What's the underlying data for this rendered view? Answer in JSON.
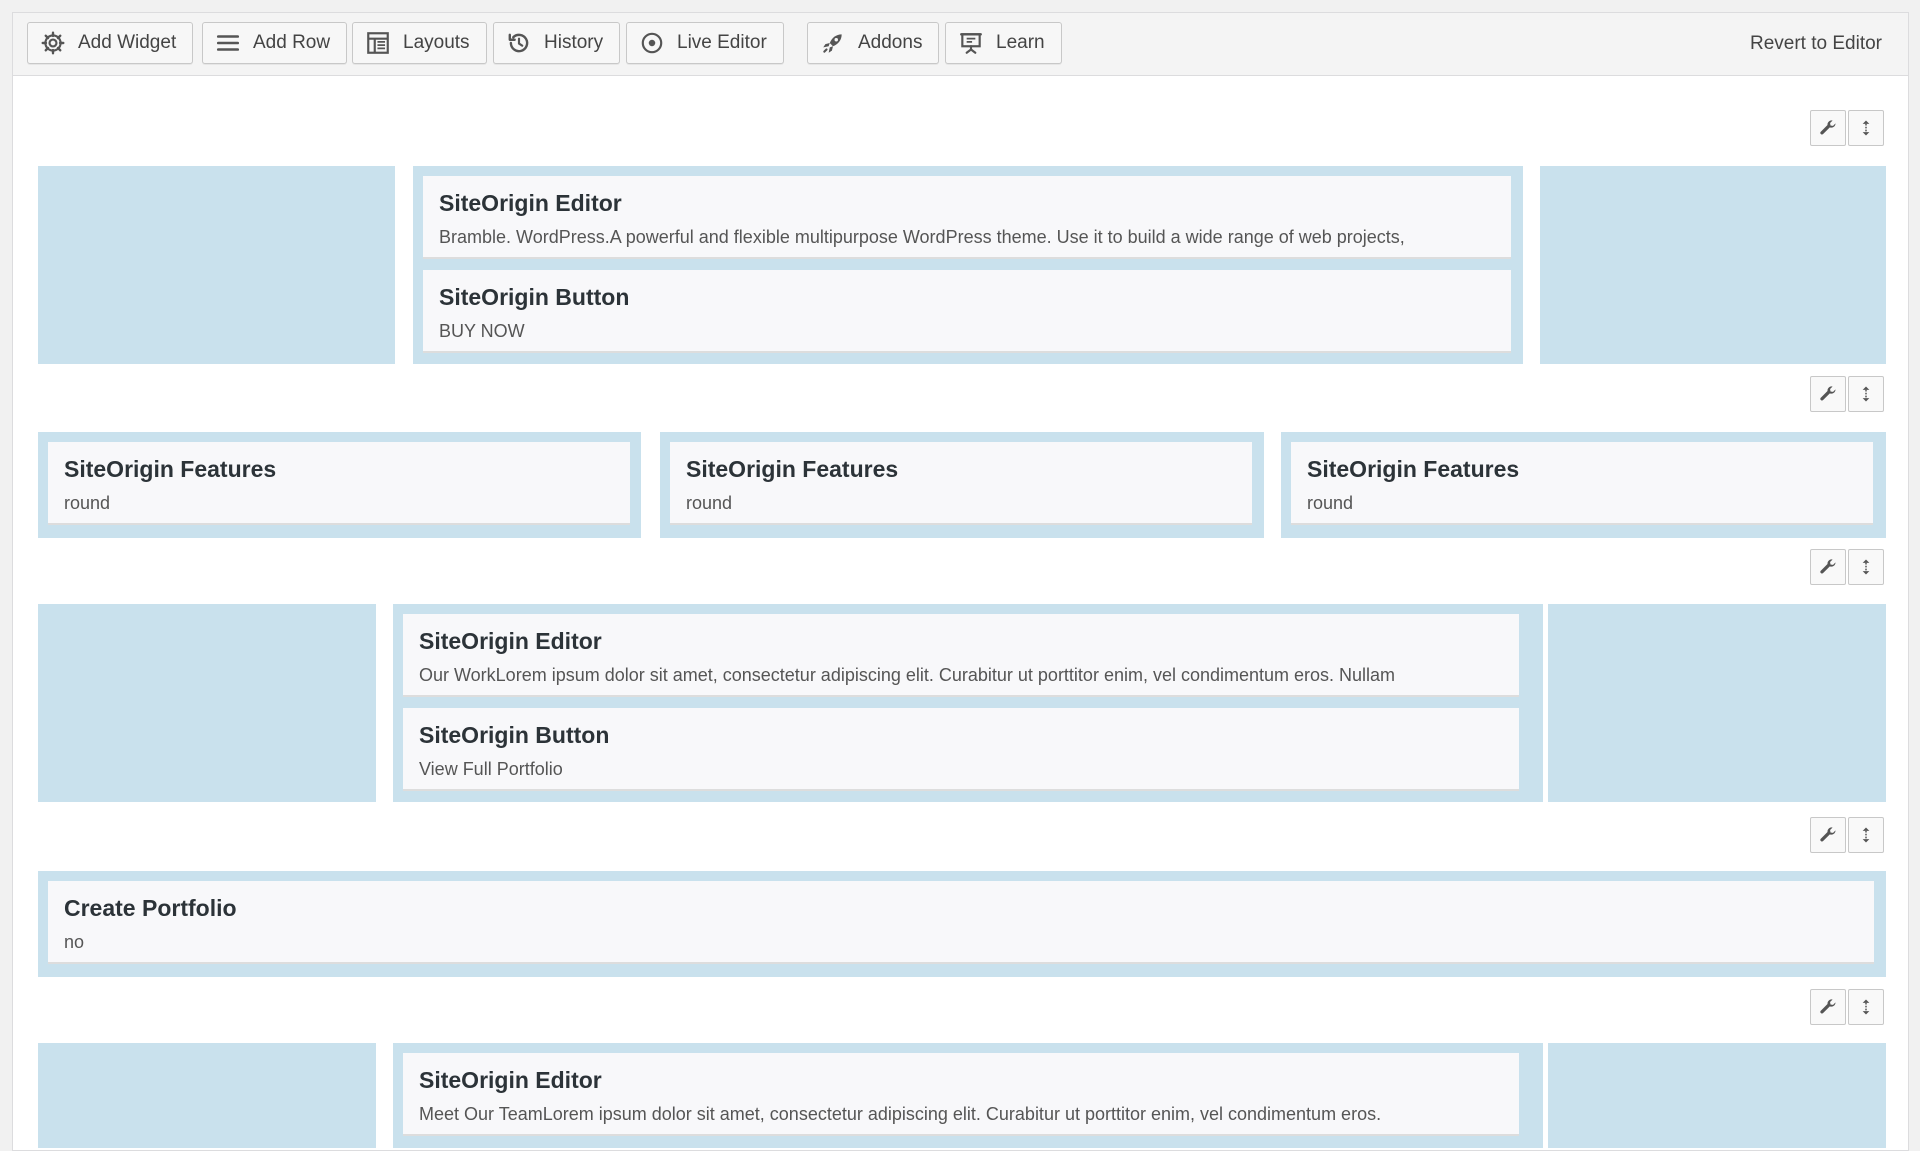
{
  "toolbar": {
    "buttons": [
      {
        "label": "Add Widget",
        "icon": "gear-icon"
      },
      {
        "label": "Add Row",
        "icon": "rows-icon"
      },
      {
        "label": "Layouts",
        "icon": "layout-icon"
      },
      {
        "label": "History",
        "icon": "history-icon"
      },
      {
        "label": "Live Editor",
        "icon": "eye-icon"
      },
      {
        "label": "Addons",
        "icon": "rocket-icon"
      },
      {
        "label": "Learn",
        "icon": "presentation-icon"
      }
    ],
    "revert_label": "Revert to Editor"
  },
  "colors": {
    "cell_bg": "#c9e1ed",
    "widget_bg": "#f8f8fa",
    "toolbar_bg": "#f4f4f4"
  },
  "rows": [
    {
      "widgets": [
        {
          "title": "SiteOrigin Editor",
          "desc": "Bramble. WordPress.A powerful and flexible multipurpose WordPress theme. Use it to build a wide range of web projects,"
        },
        {
          "title": "SiteOrigin Button",
          "desc": "BUY NOW"
        }
      ]
    },
    {
      "widgets": [
        {
          "title": "SiteOrigin Features",
          "desc": "round"
        },
        {
          "title": "SiteOrigin Features",
          "desc": "round"
        },
        {
          "title": "SiteOrigin Features",
          "desc": "round"
        }
      ]
    },
    {
      "widgets": [
        {
          "title": "SiteOrigin Editor",
          "desc": "Our WorkLorem ipsum dolor sit amet, consectetur adipiscing elit. Curabitur ut porttitor enim, vel condimentum eros. Nullam"
        },
        {
          "title": "SiteOrigin Button",
          "desc": "View Full Portfolio"
        }
      ]
    },
    {
      "widgets": [
        {
          "title": "Create Portfolio",
          "desc": "no"
        }
      ]
    },
    {
      "widgets": [
        {
          "title": "SiteOrigin Editor",
          "desc": "Meet Our TeamLorem ipsum dolor sit amet, consectetur adipiscing elit. Curabitur ut porttitor enim, vel condimentum eros."
        }
      ]
    }
  ]
}
